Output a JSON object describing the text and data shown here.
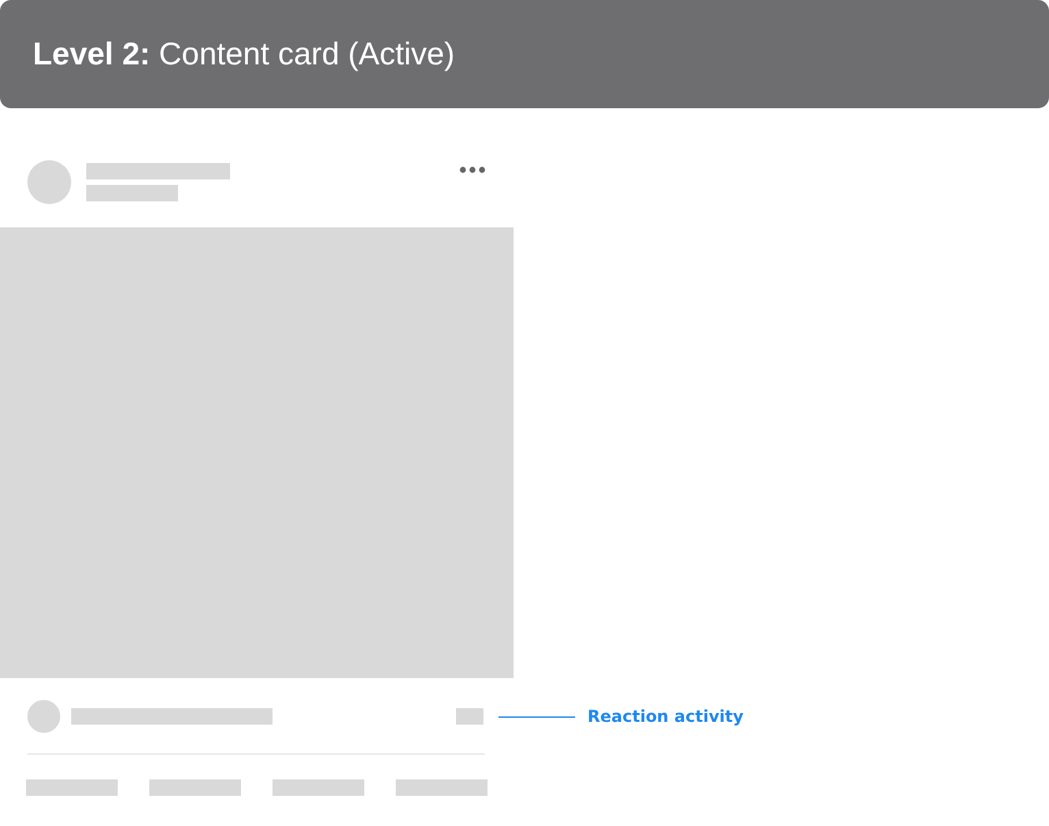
{
  "header": {
    "title": "**Level 2:** Content card (Active)"
  },
  "annotation": {
    "label": "Reaction activity"
  }
}
